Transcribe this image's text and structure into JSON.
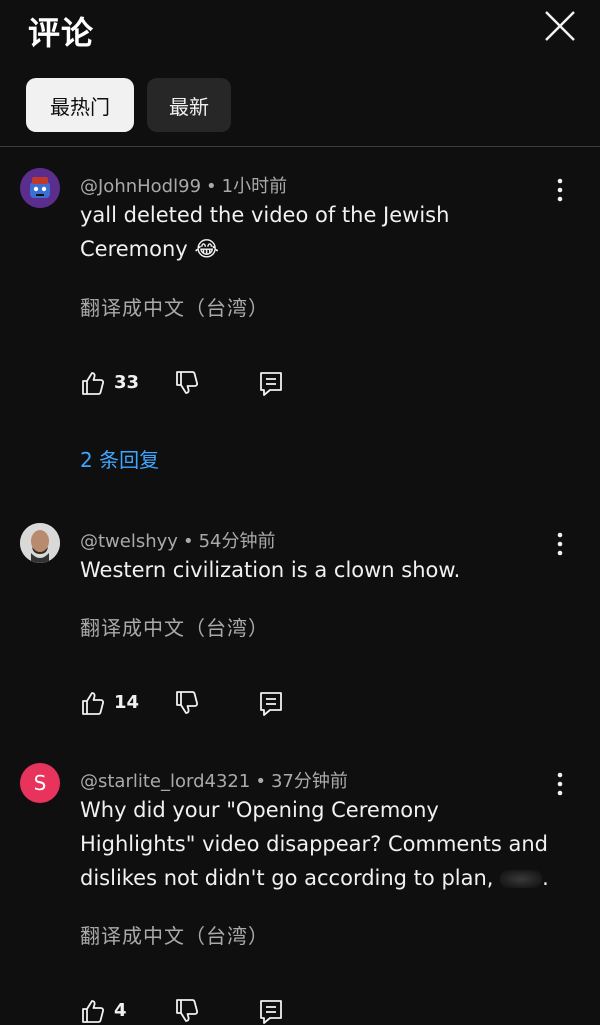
{
  "header": {
    "title": "评论",
    "close_icon": "close-icon"
  },
  "sort_chips": [
    {
      "label": "最热门",
      "selected": true
    },
    {
      "label": "最新",
      "selected": false
    }
  ],
  "comments": [
    {
      "author": "@JohnHodl99",
      "time": "1小时前",
      "text": "yall deleted the video of the Jewish Ceremony 😂",
      "translate": "翻译成中文（台湾）",
      "likes": "33",
      "replies": "2 条回复",
      "avatar_icon": "cartoon-avatar-icon"
    },
    {
      "author": "@twelshyy",
      "time": "54分钟前",
      "text": "Western civilization is a clown show.",
      "translate": "翻译成中文（台湾）",
      "likes": "14",
      "avatar_icon": "photo-avatar-icon"
    },
    {
      "author": "@starlite_lord4321",
      "time": "37分钟前",
      "text_before_blur": "Why did your \"Opening Ceremony Highlights\" video disappear? Comments and dislikes not didn't go according to plan, ",
      "text_after_blur": ".",
      "translate": "翻译成中文（台湾）",
      "likes": "4",
      "avatar_letter": "S"
    }
  ],
  "colors": {
    "background": "#0f0f0f",
    "link": "#3ea6ff",
    "avatar_s": "#e8335d"
  }
}
